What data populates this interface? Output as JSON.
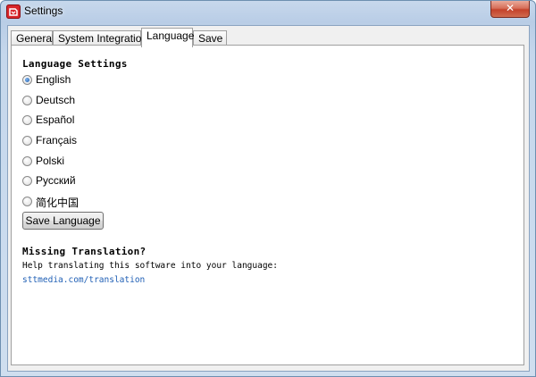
{
  "window": {
    "title": "Settings",
    "close_label": "✕"
  },
  "tabs": [
    {
      "label": "General"
    },
    {
      "label": "System Integration"
    },
    {
      "label": "Language"
    },
    {
      "label": "Save"
    }
  ],
  "active_tab": "Language",
  "language_settings": {
    "heading": "Language Settings",
    "options": [
      {
        "label": "English",
        "selected": true
      },
      {
        "label": "Deutsch",
        "selected": false
      },
      {
        "label": "Español",
        "selected": false
      },
      {
        "label": "Français",
        "selected": false
      },
      {
        "label": "Polski",
        "selected": false
      },
      {
        "label": "Русский",
        "selected": false
      },
      {
        "label": "简化中国",
        "selected": false
      }
    ],
    "save_button": "Save Language"
  },
  "missing_translation": {
    "heading": "Missing Translation?",
    "text": "Help translating this software into your language:",
    "link": "sttmedia.com/translation"
  }
}
